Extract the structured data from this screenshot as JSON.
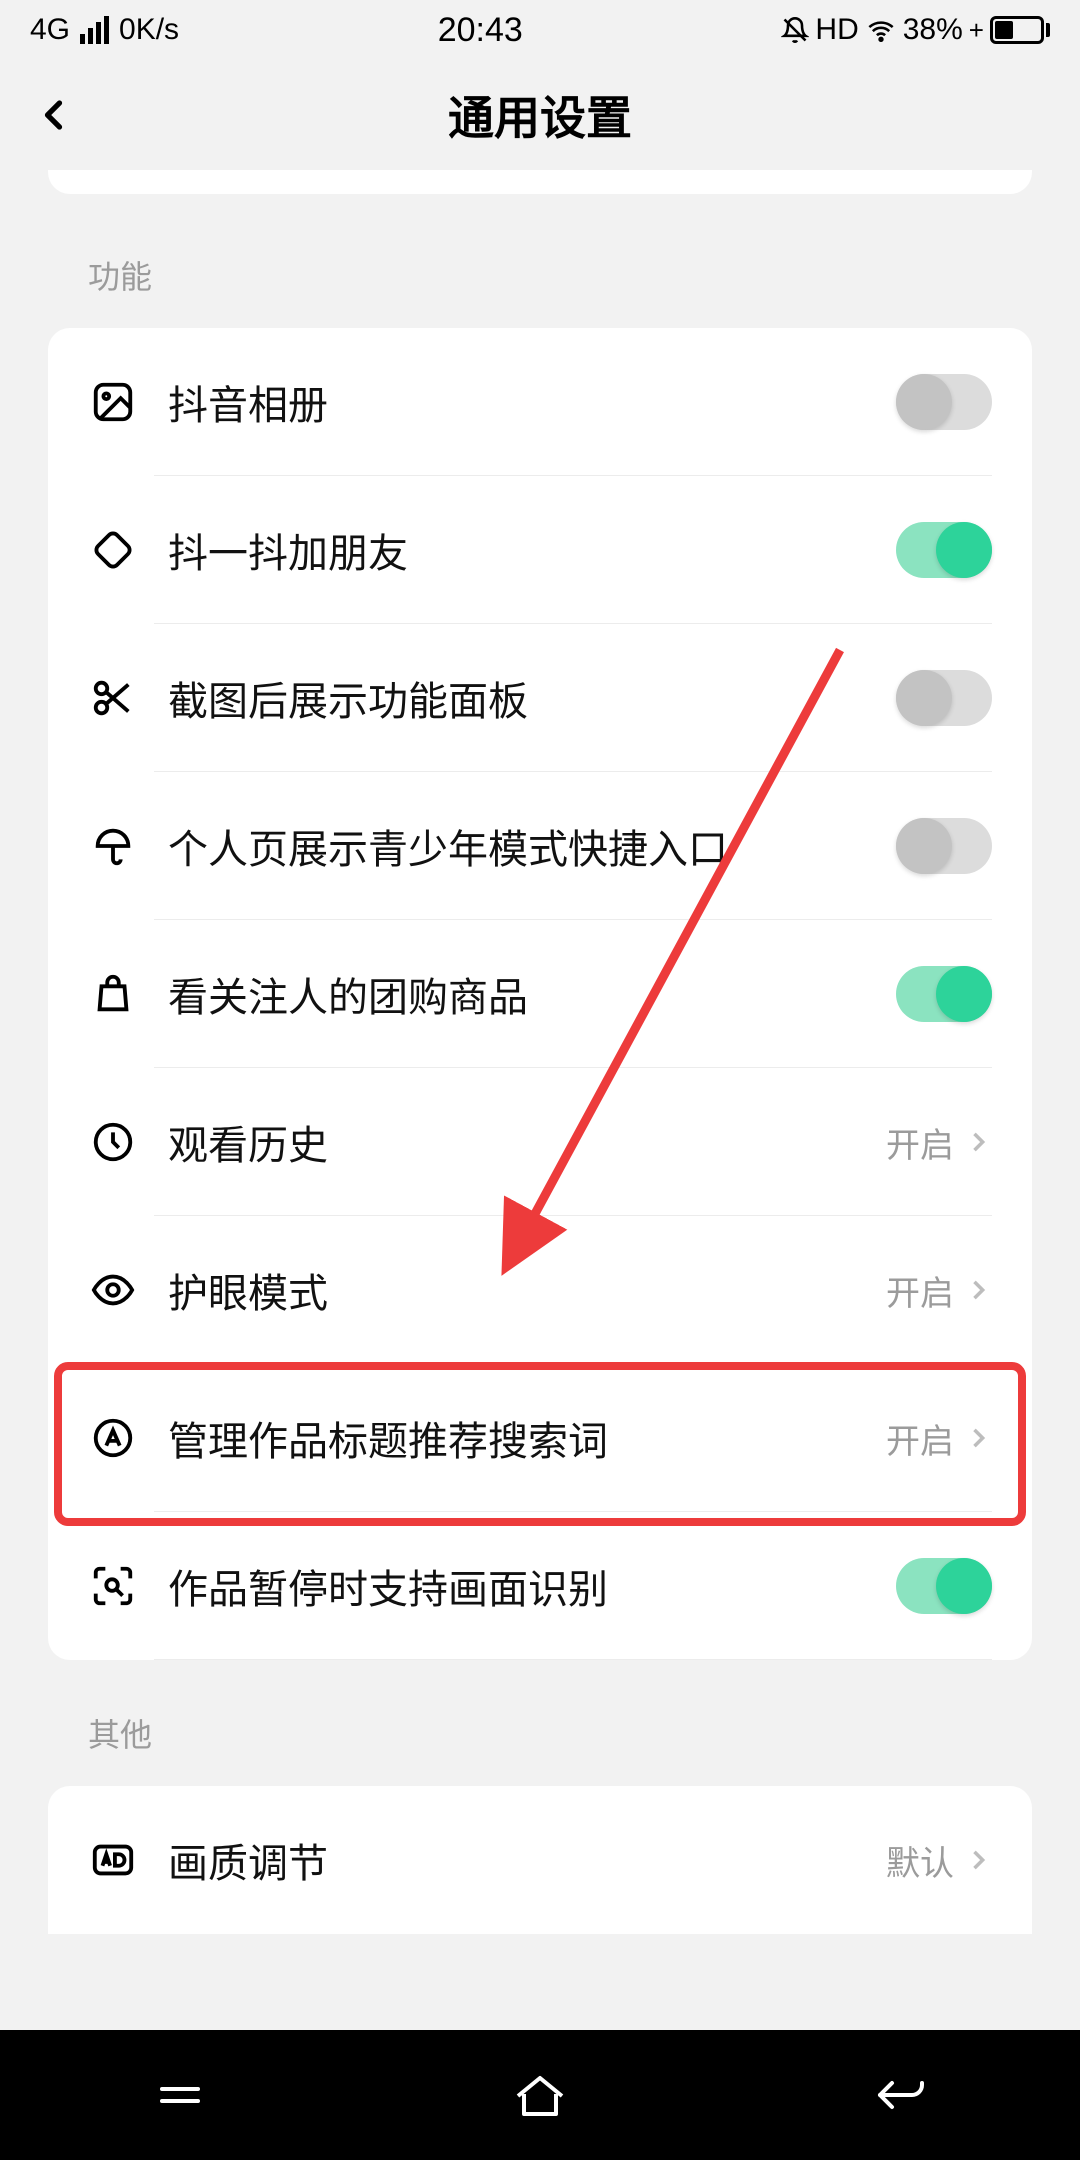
{
  "status": {
    "network": "4G",
    "speed": "0K/s",
    "time": "20:43",
    "hd": "HD",
    "battery_pct": "38%"
  },
  "header": {
    "title": "通用设置"
  },
  "sections": {
    "features_title": "功能",
    "other_title": "其他"
  },
  "rows": {
    "album": {
      "label": "抖音相册",
      "on": false
    },
    "shake": {
      "label": "抖一抖加朋友",
      "on": true
    },
    "screenshot": {
      "label": "截图后展示功能面板",
      "on": false
    },
    "youth": {
      "label": "个人页展示青少年模式快捷入口",
      "on": false
    },
    "group_buy": {
      "label": "看关注人的团购商品",
      "on": true
    },
    "history": {
      "label": "观看历史",
      "value": "开启"
    },
    "eye": {
      "label": "护眼模式",
      "value": "开启"
    },
    "manage_title": {
      "label": "管理作品标题推荐搜索词",
      "value": "开启"
    },
    "pause_recognize": {
      "label": "作品暂停时支持画面识别",
      "on": true
    },
    "quality": {
      "label": "画质调节",
      "value": "默认"
    }
  }
}
